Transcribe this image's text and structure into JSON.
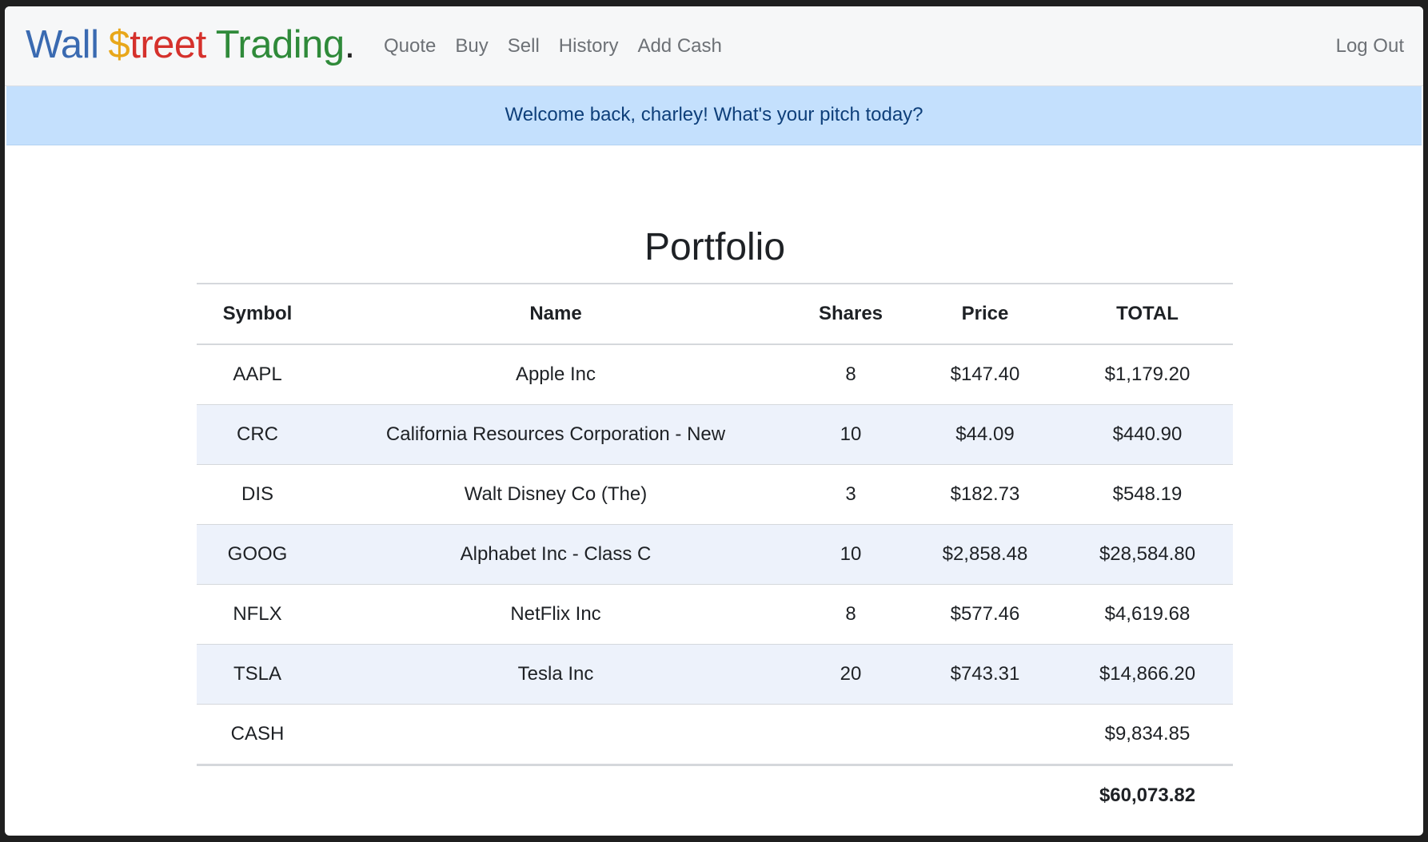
{
  "brand": {
    "part1": "Wall",
    "part2": "$",
    "part3": "treet",
    "part4": "Trading",
    "part5": ".",
    "colors": {
      "wall": "#3a6ab1",
      "dollar": "#e8a71a",
      "treet": "#d5312c",
      "trading": "#2f8a3a"
    }
  },
  "nav": {
    "items": [
      {
        "label": "Quote"
      },
      {
        "label": "Buy"
      },
      {
        "label": "Sell"
      },
      {
        "label": "History"
      },
      {
        "label": "Add Cash"
      }
    ],
    "logout": "Log Out"
  },
  "alert": {
    "message": "Welcome back, charley! What's your pitch today?"
  },
  "portfolio": {
    "title": "Portfolio",
    "headers": [
      "Symbol",
      "Name",
      "Shares",
      "Price",
      "TOTAL"
    ],
    "rows": [
      {
        "symbol": "AAPL",
        "name": "Apple Inc",
        "shares": "8",
        "price": "$147.40",
        "total": "$1,179.20"
      },
      {
        "symbol": "CRC",
        "name": "California Resources Corporation - New",
        "shares": "10",
        "price": "$44.09",
        "total": "$440.90"
      },
      {
        "symbol": "DIS",
        "name": "Walt Disney Co (The)",
        "shares": "3",
        "price": "$182.73",
        "total": "$548.19"
      },
      {
        "symbol": "GOOG",
        "name": "Alphabet Inc - Class C",
        "shares": "10",
        "price": "$2,858.48",
        "total": "$28,584.80"
      },
      {
        "symbol": "NFLX",
        "name": "NetFlix Inc",
        "shares": "8",
        "price": "$577.46",
        "total": "$4,619.68"
      },
      {
        "symbol": "TSLA",
        "name": "Tesla Inc",
        "shares": "20",
        "price": "$743.31",
        "total": "$14,866.20"
      }
    ],
    "cash": {
      "symbol": "CASH",
      "total": "$9,834.85"
    },
    "grand_total": "$60,073.82"
  }
}
